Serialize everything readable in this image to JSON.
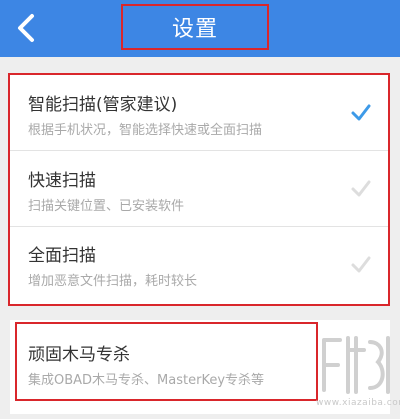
{
  "header": {
    "title": "设置",
    "back_icon": "chevron-left-icon",
    "background_color": "#3d86e4"
  },
  "scan_modes": [
    {
      "title": "智能扫描(管家建议)",
      "subtitle": "根据手机状况，智能选择快速或全面扫描",
      "selected": true
    },
    {
      "title": "快速扫描",
      "subtitle": "扫描关键位置、已安装软件",
      "selected": false
    },
    {
      "title": "全面扫描",
      "subtitle": "增加恶意文件扫描，耗时较长",
      "selected": false
    }
  ],
  "trojan_kill": {
    "title": "顽固木马专杀",
    "subtitle": "集成OBAD木马专杀、MasterKey专杀等"
  },
  "watermark": {
    "text": "www.xiazaiba.com"
  },
  "colors": {
    "check_selected": "#3d9ae8",
    "check_unselected": "#dddddd",
    "highlight_outline": "#d9262b"
  }
}
